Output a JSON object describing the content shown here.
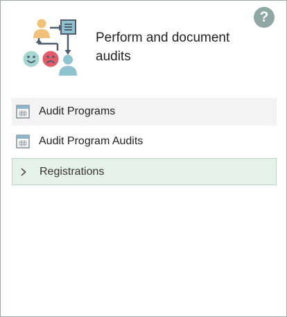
{
  "header": {
    "title": "Perform and document audits",
    "help_icon": "?"
  },
  "menu": {
    "items": [
      {
        "label": "Audit Programs",
        "icon": "calendar-icon"
      },
      {
        "label": "Audit Program Audits",
        "icon": "calendar-icon"
      },
      {
        "label": "Registrations",
        "icon": "chevron-right-icon"
      }
    ]
  },
  "colors": {
    "help_bg": "#8fa8a3",
    "active_row_bg": "#f3f3f3",
    "expandable_row_bg": "#e6f2e9",
    "expandable_row_border": "#b9d6c2"
  }
}
